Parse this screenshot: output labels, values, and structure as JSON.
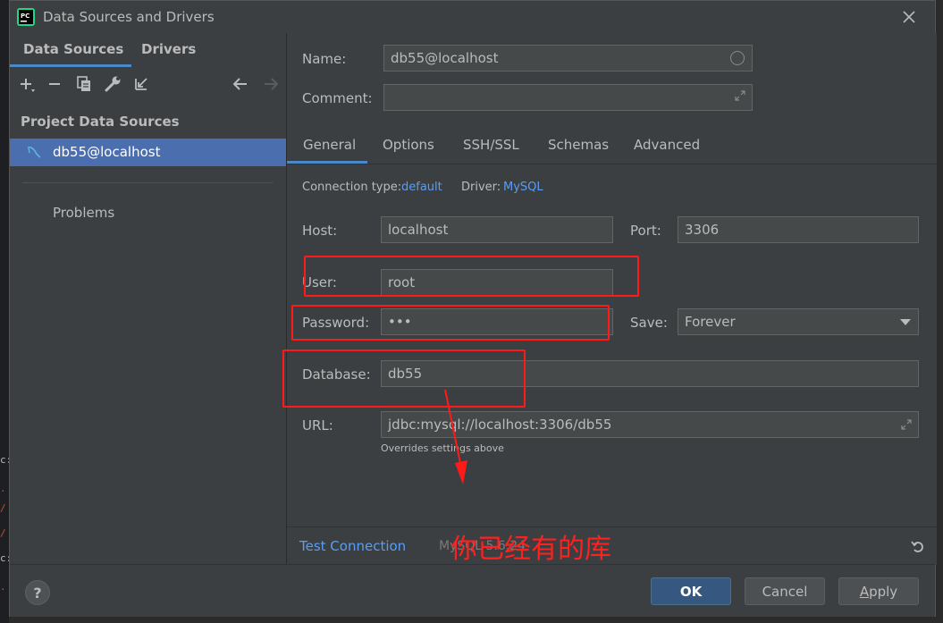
{
  "window": {
    "title": "Data Sources and Drivers",
    "app_icon_text": "PC"
  },
  "left_panel": {
    "tabs": [
      {
        "label": "Data Sources"
      },
      {
        "label": "Drivers"
      }
    ],
    "section_header": "Project Data Sources",
    "selected_item": "db55@localhost",
    "problems_label": "Problems",
    "toolbar_icons": [
      "add-icon",
      "remove-icon",
      "duplicate-icon",
      "wrench-icon",
      "import-icon",
      "back-icon",
      "forward-icon"
    ]
  },
  "form": {
    "name_label": "Name:",
    "name_value": "db55@localhost",
    "comment_label": "Comment:",
    "comment_value": "",
    "tabs": [
      {
        "label": "General"
      },
      {
        "label": "Options"
      },
      {
        "label": "SSH/SSL"
      },
      {
        "label": "Schemas"
      },
      {
        "label": "Advanced"
      }
    ],
    "connection_type_label": "Connection type:",
    "connection_type_value": "default",
    "driver_label": "Driver:",
    "driver_value": "MySQL",
    "host_label": "Host:",
    "host_value": "localhost",
    "port_label": "Port:",
    "port_value": "3306",
    "user_label": "User:",
    "user_value": "root",
    "password_label": "Password:",
    "password_value": "•••",
    "save_label": "Save:",
    "save_value": "Forever",
    "database_label": "Database:",
    "database_value": "db55",
    "url_label": "URL:",
    "url_value": "jdbc:mysql://localhost:3306/db55",
    "url_hint": "Overrides settings above"
  },
  "bottom_strip": {
    "test_connection": "Test Connection",
    "version_text": "MySQL 5.6.24"
  },
  "footer": {
    "help": "?",
    "ok": "OK",
    "cancel": "Cancel",
    "apply_mnemonic": "A",
    "apply_rest": "pply"
  },
  "annotation": {
    "text": "你已经有的库",
    "color": "#ff1a1a"
  },
  "colors": {
    "accent": "#4a88c7",
    "selection": "#4b6eaf",
    "link": "#589df6",
    "panel_bg": "#3c3f41",
    "field_bg": "#45494a",
    "primary_button": "#365880"
  }
}
